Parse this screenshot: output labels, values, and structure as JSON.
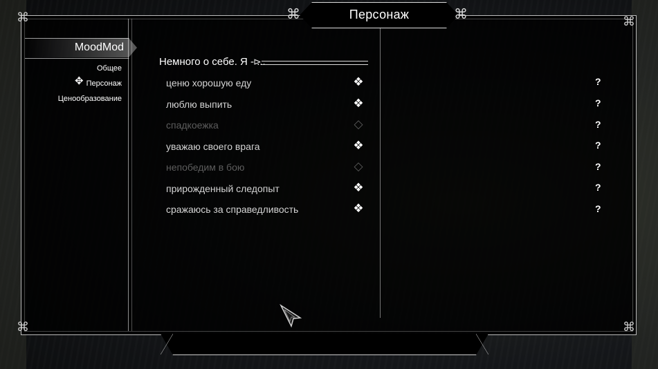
{
  "window": {
    "title": "Персонаж"
  },
  "sidebar": {
    "mod_name": "MoodMod",
    "items": [
      {
        "label": "Общее",
        "selected": false
      },
      {
        "label": "Персонаж",
        "selected": true
      },
      {
        "label": "Ценообразование",
        "selected": false
      }
    ]
  },
  "content": {
    "header": "Немного о себе. Я - ...",
    "options": [
      {
        "label": "ценю хорошую еду",
        "checked": true,
        "help": "?"
      },
      {
        "label": "люблю выпить",
        "checked": true,
        "help": "?"
      },
      {
        "label": "спадкоежка",
        "checked": false,
        "help": "?"
      },
      {
        "label": "уважаю своего врага",
        "checked": true,
        "help": "?"
      },
      {
        "label": "непобедим в бою",
        "checked": false,
        "help": "?"
      },
      {
        "label": "прирожденный следопыт",
        "checked": true,
        "help": "?"
      },
      {
        "label": "сражаюсь за справедливость",
        "checked": true,
        "help": "?"
      }
    ]
  },
  "icons": {
    "checkbox_on": "checkbox-checked-icon",
    "checkbox_off": "checkbox-empty-icon",
    "corner": "celtic-knot-icon",
    "cursor": "arrow-cursor-icon"
  },
  "colors": {
    "text": "#ffffff",
    "disabled": "#5d5d5d",
    "frame": "#bdbdbd",
    "panel": "#000000"
  }
}
